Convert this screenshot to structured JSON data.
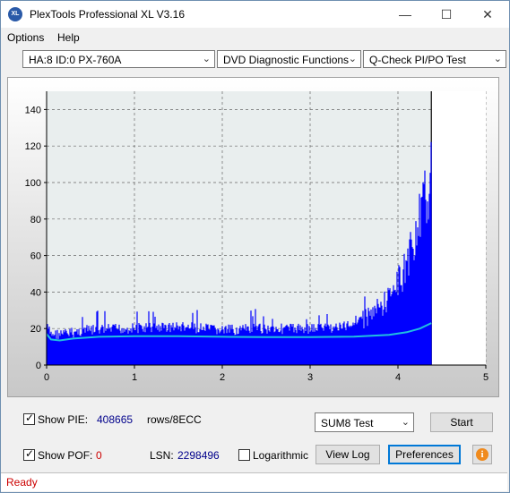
{
  "window": {
    "title": "PlexTools Professional XL V3.16",
    "icon_text": "XL"
  },
  "menu": {
    "options": "Options",
    "help": "Help"
  },
  "toolbar": {
    "drive": "HA:8 ID:0  PX-760A",
    "function": "DVD Diagnostic Functions",
    "test": "Q-Check PI/PO Test"
  },
  "chart_data": {
    "type": "area",
    "xlim": [
      0,
      5
    ],
    "ylim": [
      0,
      150
    ],
    "x_ticks": [
      "0",
      "1",
      "2",
      "3",
      "4",
      "5"
    ],
    "y_ticks": [
      "0",
      "20",
      "40",
      "60",
      "80",
      "100",
      "120",
      "140"
    ],
    "grid": true,
    "data_end_x": 4.38,
    "series": [
      {
        "kind": "pie_bars",
        "color": "#0000ff",
        "points": [
          [
            0,
            24
          ],
          [
            0.05,
            20
          ],
          [
            0.2,
            20
          ],
          [
            0.45,
            22
          ],
          [
            0.9,
            23
          ],
          [
            1.5,
            24
          ],
          [
            2.0,
            22
          ],
          [
            2.5,
            23
          ],
          [
            3.0,
            23
          ],
          [
            3.4,
            24
          ],
          [
            3.6,
            30
          ],
          [
            3.8,
            38
          ],
          [
            3.95,
            48
          ],
          [
            4.05,
            60
          ],
          [
            4.15,
            75
          ],
          [
            4.25,
            95
          ],
          [
            4.32,
            110
          ],
          [
            4.38,
            135
          ]
        ]
      },
      {
        "kind": "pie_avg",
        "color": "#20c0e0",
        "points": [
          [
            0,
            17
          ],
          [
            0.05,
            14
          ],
          [
            0.15,
            13.5
          ],
          [
            0.3,
            14.5
          ],
          [
            0.6,
            15.5
          ],
          [
            1.0,
            15.8
          ],
          [
            1.5,
            15.8
          ],
          [
            2.0,
            15.5
          ],
          [
            2.5,
            15.3
          ],
          [
            3.0,
            15.3
          ],
          [
            3.5,
            15.6
          ],
          [
            3.9,
            16.5
          ],
          [
            4.1,
            18
          ],
          [
            4.25,
            20
          ],
          [
            4.38,
            23
          ]
        ]
      }
    ]
  },
  "controls": {
    "show_pie_label": "Show PIE:",
    "pie_value": "408665",
    "pie_unit": "rows/8ECC",
    "show_pof_label": "Show POF:",
    "pof_value": "0",
    "lsn_label": "LSN:",
    "lsn_value": "2298496",
    "logarithmic_label": "Logarithmic",
    "sum_select": "SUM8 Test",
    "start": "Start",
    "view_log": "View Log",
    "preferences": "Preferences"
  },
  "status": {
    "text": "Ready"
  },
  "colors": {
    "pie": "#0000ff",
    "avg": "#20c0e0",
    "status_text": "#cc0000"
  }
}
